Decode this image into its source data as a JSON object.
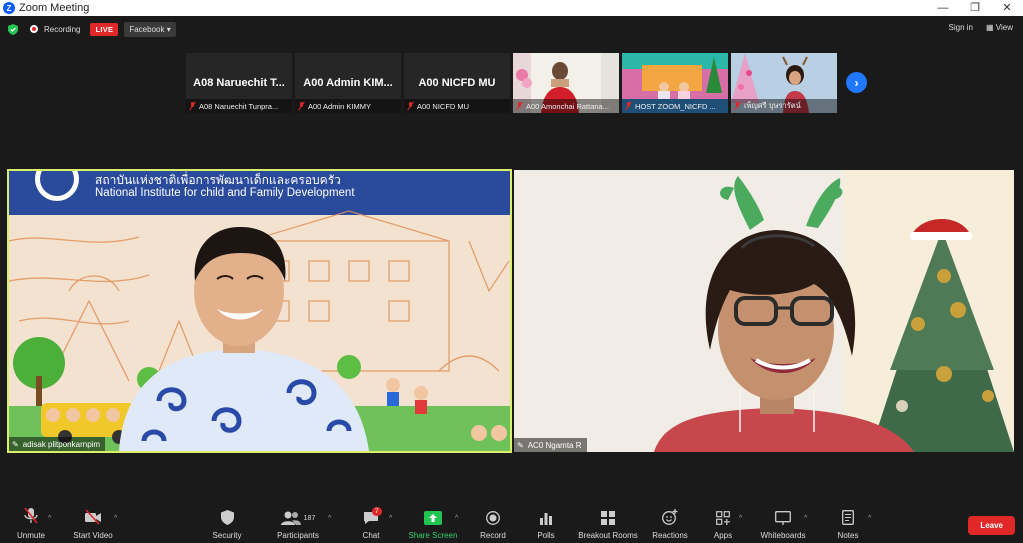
{
  "window": {
    "title": "Zoom Meeting",
    "controls": [
      "—",
      "❐",
      "✕"
    ]
  },
  "topbar": {
    "recording_label": "Recording",
    "live_label": "LIVE",
    "stream_label": "Facebook",
    "stream_caret": "▾",
    "signin_label": "Sign in",
    "view_label": "View"
  },
  "strip": {
    "tiles": [
      {
        "big": "A08  Naruechit  T...",
        "label": "A08 Naruechit Tunpra..."
      },
      {
        "big": "A00  Admin  KIM...",
        "label": "A00 Admin KIMMY"
      },
      {
        "big": "A00  NICFD  MU",
        "label": "A00 NICFD MU"
      },
      {
        "big": "",
        "label": "A00 Amonchai Rattana..."
      },
      {
        "big": "",
        "label": "HOST ZOOM_NICFD ..."
      },
      {
        "big": "",
        "label": "เพ็ญศรี บุษรารัตน์"
      }
    ],
    "next_label": "›"
  },
  "main_video": {
    "banner_thai": "สถาบันแห่งชาติเพื่อการพัฒนาเด็กและครอบครัว",
    "banner_en": "National  Institute for child and Family Development",
    "name": "adisak plitponkarnpim"
  },
  "second_video": {
    "name": "AC0 Ngamta R"
  },
  "toolbar": {
    "unmute": "Unmute",
    "start_video": "Start Video",
    "security": "Security",
    "participants": "Participants",
    "participants_count": "187",
    "chat": "Chat",
    "chat_badge": "7",
    "share_screen": "Share Screen",
    "record": "Record",
    "polls": "Polls",
    "breakout": "Breakout Rooms",
    "reactions": "Reactions",
    "apps": "Apps",
    "whiteboards": "Whiteboards",
    "notes": "Notes",
    "leave": "Leave",
    "caret": "^"
  },
  "colors": {
    "accent": "#0b5cff",
    "live": "#e02828",
    "active_speaker": "#dcef6a",
    "share": "#2fd06b"
  }
}
